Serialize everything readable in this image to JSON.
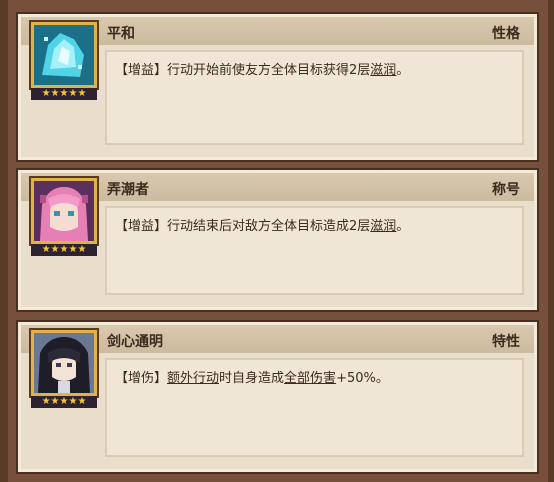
{
  "cards": [
    {
      "title": "平和",
      "tag": "性格",
      "desc_prefix": "【增益】行动开始前使友方全体目标获得2层",
      "desc_link": "滋润",
      "desc_suffix": "。",
      "stars": "★★★★★",
      "portrait_icon": "crystal-portrait-icon",
      "portrait_color": "#4fd3e6"
    },
    {
      "title": "弄潮者",
      "tag": "称号",
      "desc_prefix": "【增益】行动结束后对敌方全体目标造成2层",
      "desc_link": "滋润",
      "desc_suffix": "。",
      "stars": "★★★★★",
      "portrait_icon": "pink-hair-girl-portrait-icon",
      "portrait_color": "#e57fb6"
    },
    {
      "title": "剑心通明",
      "tag": "特性",
      "desc_prefix": "【增伤】",
      "desc_link": "额外行动",
      "desc_middle": "时自身造成",
      "desc_link2": "全部伤害",
      "desc_suffix": "+50%。",
      "stars": "★★★★★",
      "portrait_icon": "dark-hair-swordsman-portrait-icon",
      "portrait_color": "#2a2a3a"
    }
  ]
}
